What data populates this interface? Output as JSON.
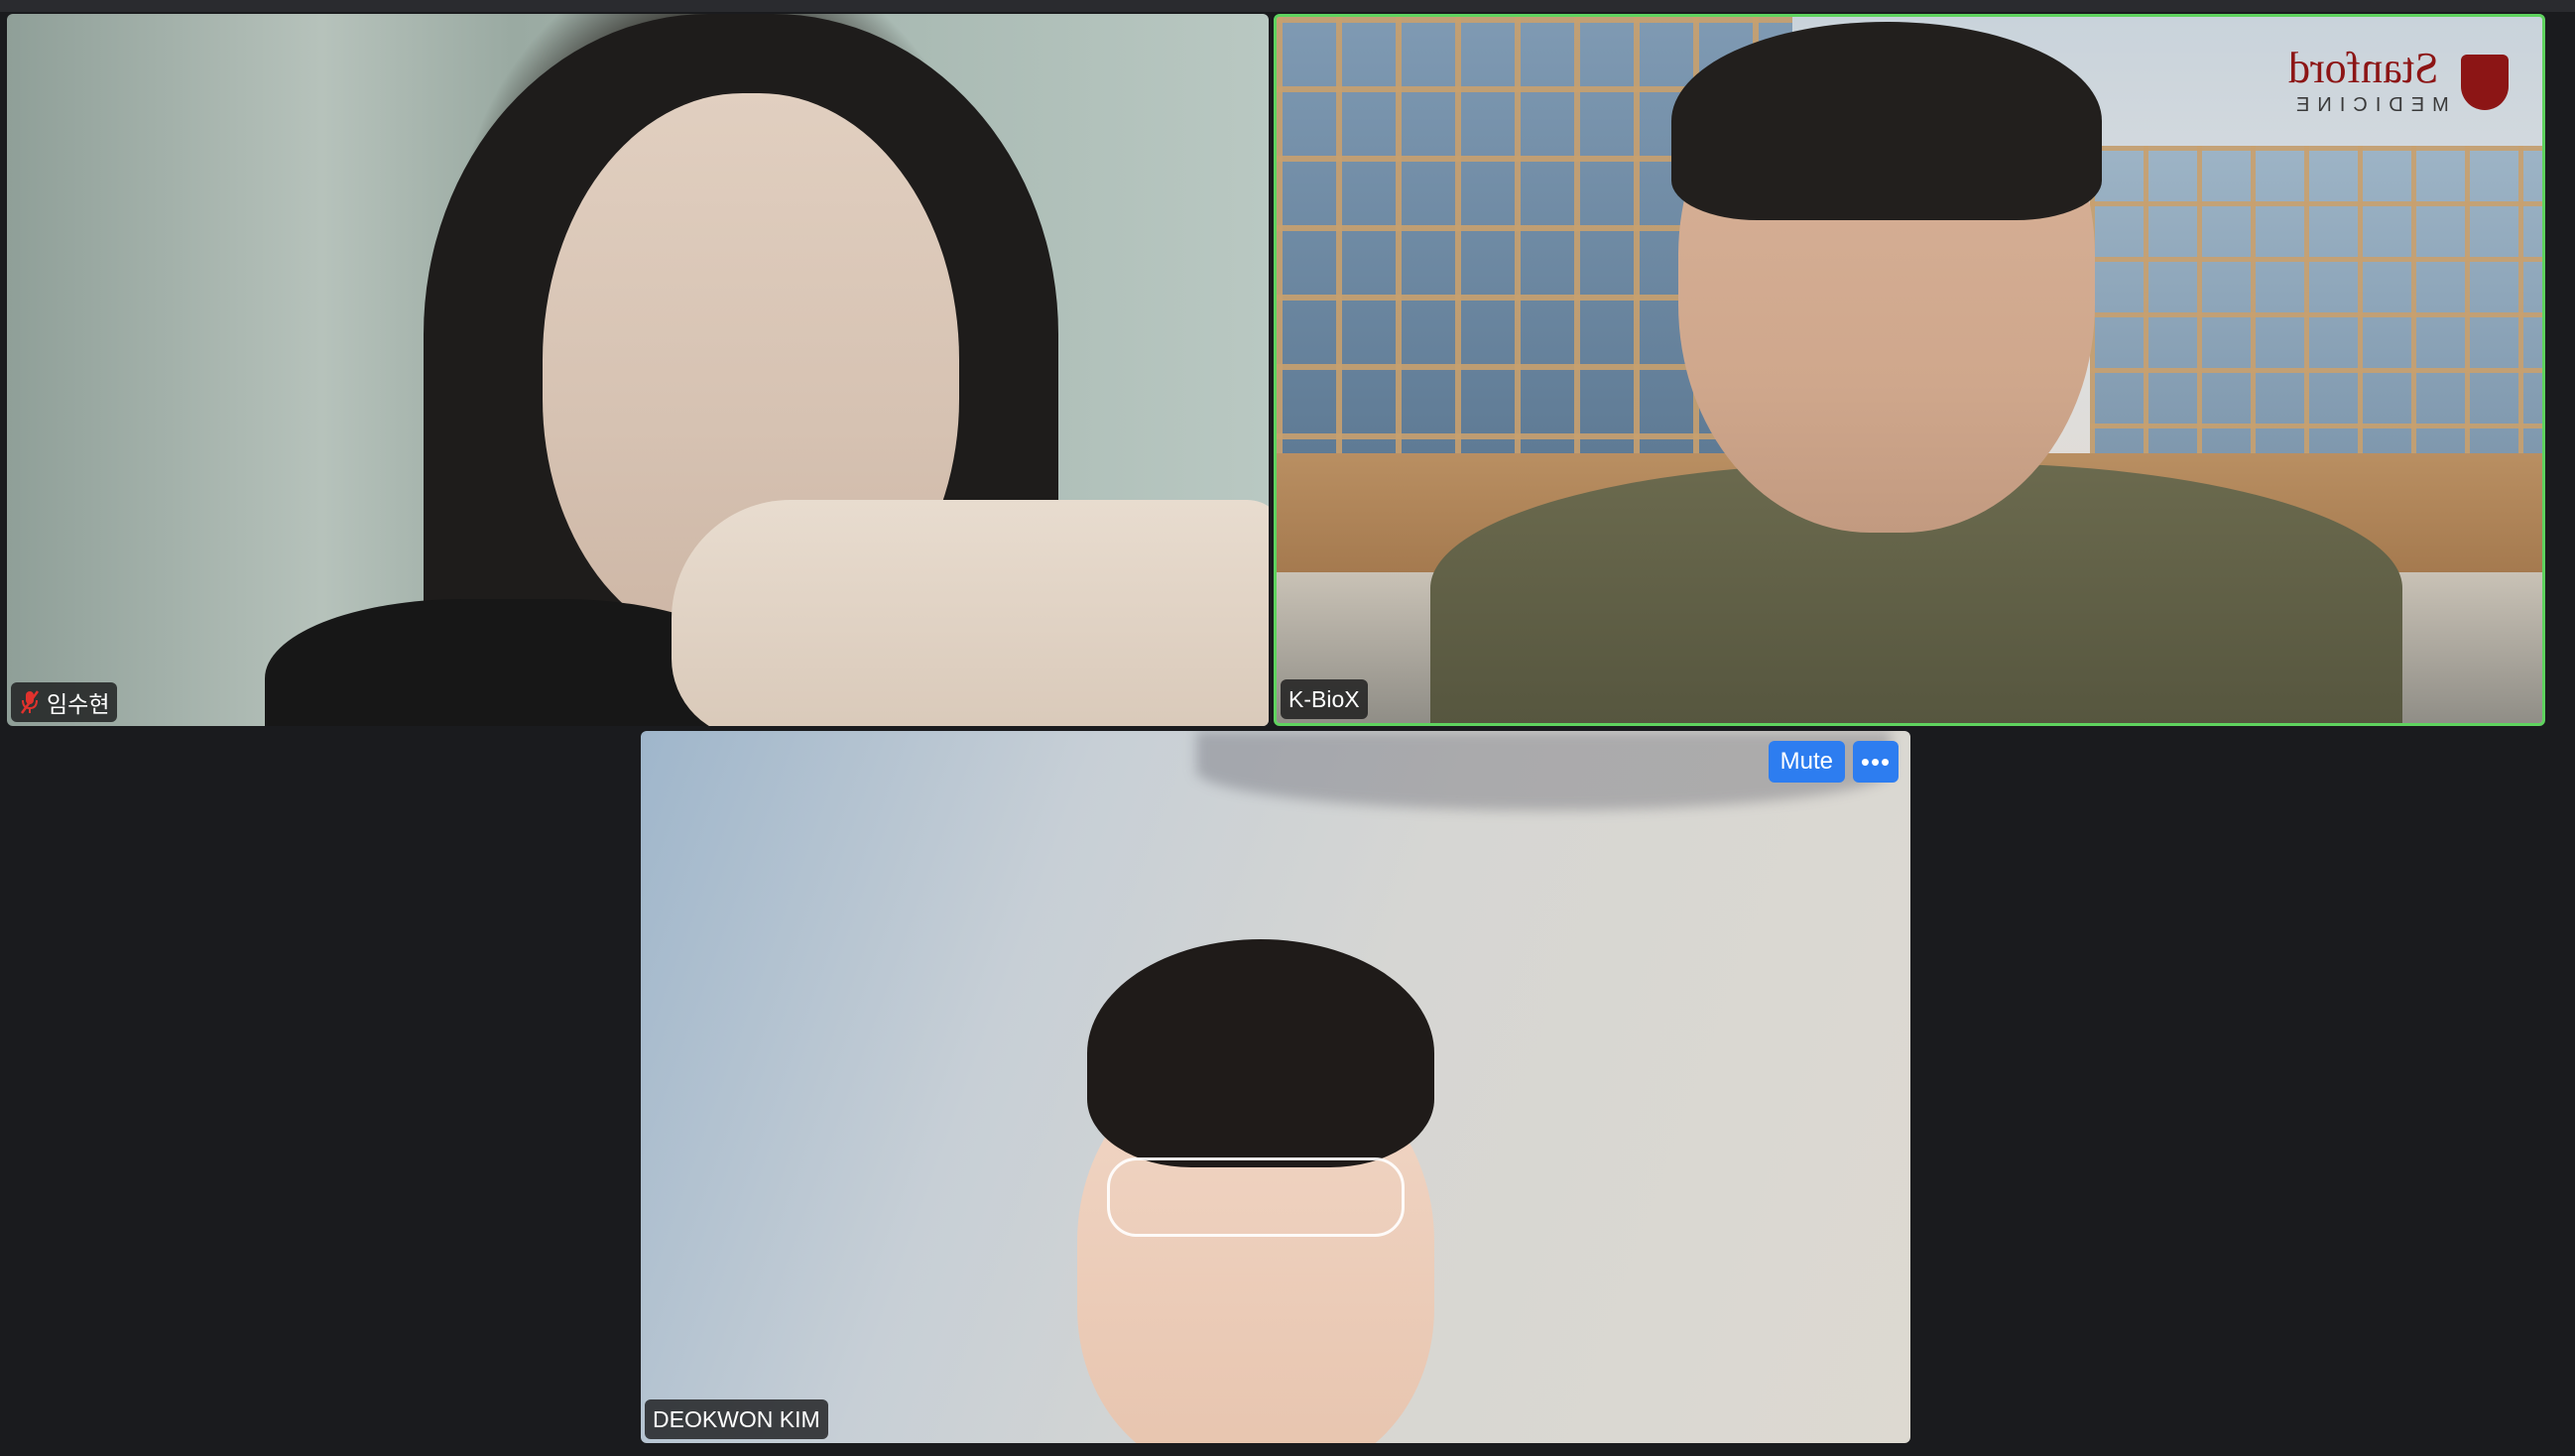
{
  "participants": [
    {
      "name": "임수현",
      "muted": true,
      "active_speaker": false
    },
    {
      "name": "K-BioX",
      "muted": false,
      "active_speaker": true,
      "background_logo": {
        "word": "Stanford",
        "sub": "MEDICINE"
      }
    },
    {
      "name": "DEOKWON KIM",
      "muted": false,
      "active_speaker": false
    }
  ],
  "hover_controls": {
    "mute_label": "Mute",
    "more_label": "•••"
  },
  "colors": {
    "background": "#1a1b1e",
    "active_speaker_border": "#5fd35f",
    "button": "#2d7df0",
    "mic_muted": "#e0322d",
    "stanford_red": "#8c1515"
  }
}
